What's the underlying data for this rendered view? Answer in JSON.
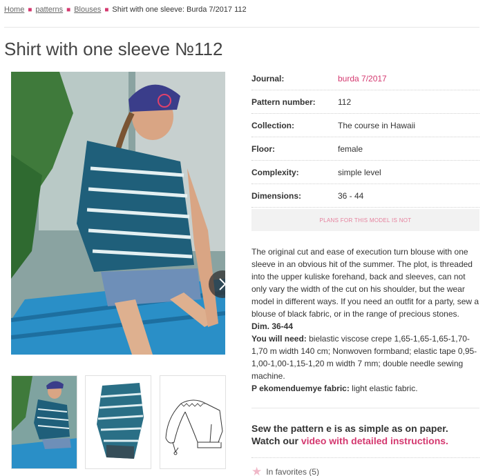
{
  "breadcrumb": {
    "items": [
      "Home",
      "patterns",
      "Blouses"
    ],
    "current": "Shirt with one sleeve: Burda 7/2017 112"
  },
  "page_title": "Shirt with one sleeve №112",
  "specs": [
    {
      "label": "Journal:",
      "value": "burda 7/2017"
    },
    {
      "label": "Pattern number:",
      "value": "112"
    },
    {
      "label": "Collection:",
      "value": "The course in Hawaii"
    },
    {
      "label": "Floor:",
      "value": "female"
    },
    {
      "label": "Complexity:",
      "value": "simple level"
    },
    {
      "label": "Dimensions:",
      "value": "36 - 44"
    }
  ],
  "plans_notice": "PLANS FOR THIS MODEL IS NOT",
  "description": {
    "intro": "The original cut and ease of execution turn blouse with one sleeve in an obvious hit of the summer. The plot, is threaded into the upper kuliske forehand, back and sleeves, can not only vary the width of the cut on his shoulder, but the wear model in different ways. If you need an outfit for a party, sew a blouse of black fabric, or in the range of precious stones.",
    "dims": "Dim. 36-44",
    "need_label": "You will need:",
    "need_text": " bielastic viscose crepe 1,65-1,65-1,65-1,70-1,70 m width 140 cm; Nonwoven formband; elastic tape 0,95-1,00-1,00-1,15-1,20 m width 7 mm; double needle sewing machine.",
    "fabric_label": "P ekomenduemye fabric:",
    "fabric_text": " light elastic fabric."
  },
  "promo": {
    "line1": "Sew the pattern e is as simple as on paper.",
    "line2_prefix": "Watch our ",
    "line2_link": "video with detailed instructions."
  },
  "favorites": {
    "label": "In favorites (5)"
  },
  "icons": {
    "next": "chevron-right-icon",
    "favorite": "star-icon"
  },
  "colors": {
    "accent": "#d4386f",
    "notice_text": "#e57f9c"
  }
}
